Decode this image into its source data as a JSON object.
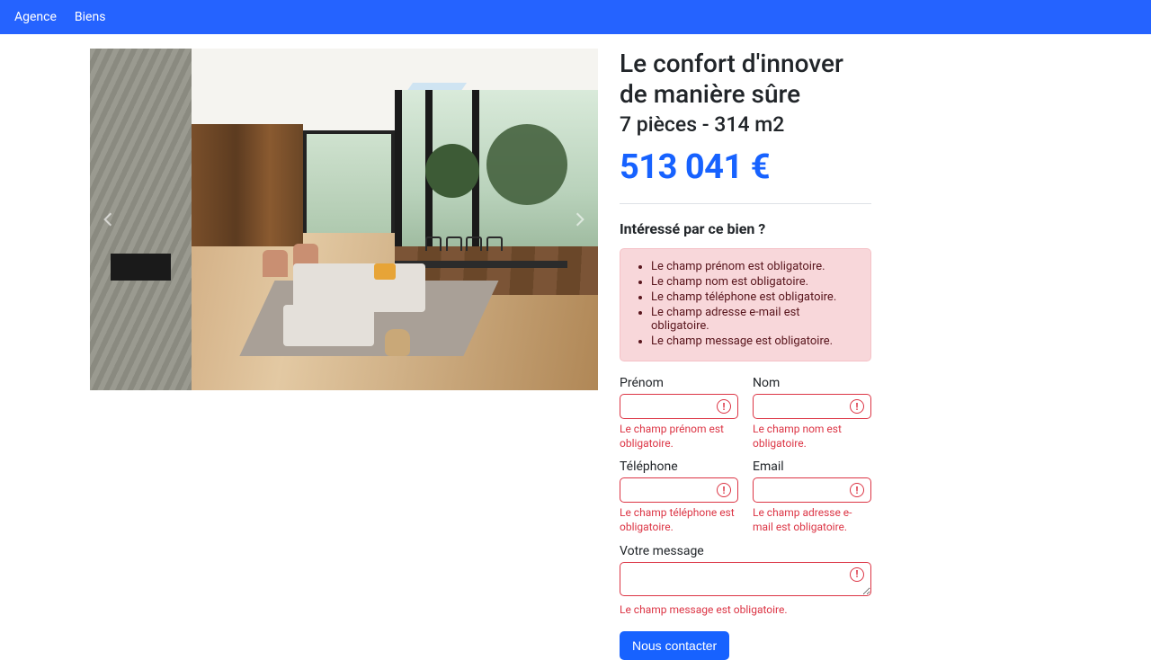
{
  "nav": {
    "brand": "Agence",
    "link1": "Biens"
  },
  "listing": {
    "title": "Le confort d'innover de manière sûre",
    "subtitle": "7 pièces - 314 m2",
    "price": "513 041 €"
  },
  "form": {
    "heading": "Intéressé par ce bien ?",
    "errors": [
      "Le champ prénom est obligatoire.",
      "Le champ nom est obligatoire.",
      "Le champ téléphone est obligatoire.",
      "Le champ adresse e-mail est obligatoire.",
      "Le champ message est obligatoire."
    ],
    "firstname_label": "Prénom",
    "firstname_error": "Le champ prénom est obligatoire.",
    "lastname_label": "Nom",
    "lastname_error": "Le champ nom est obligatoire.",
    "phone_label": "Téléphone",
    "phone_error": "Le champ téléphone est obligatoire.",
    "email_label": "Email",
    "email_error": "Le champ adresse e-mail est obligatoire.",
    "message_label": "Votre message",
    "message_error": "Le champ message est obligatoire.",
    "submit_label": "Nous contacter"
  }
}
